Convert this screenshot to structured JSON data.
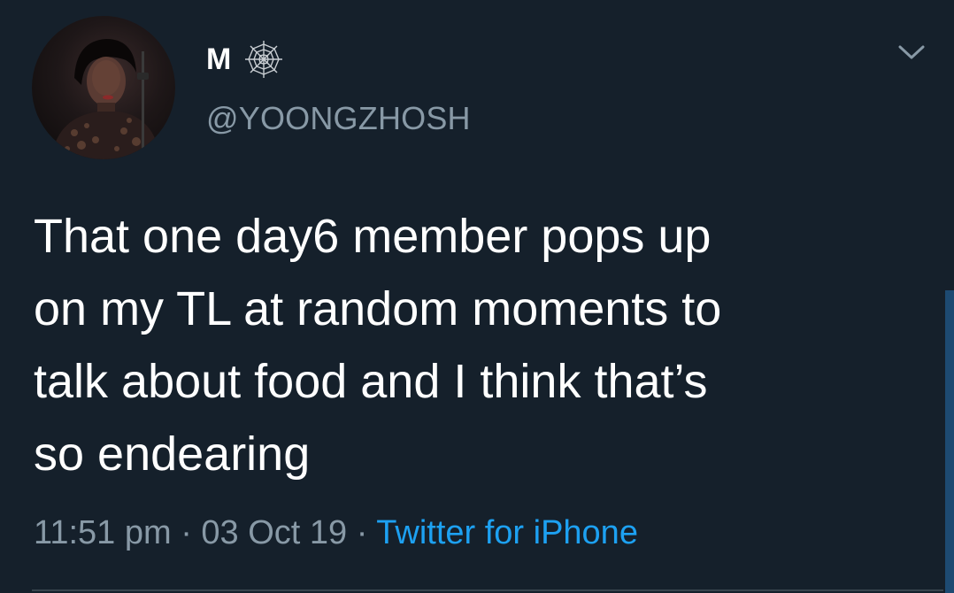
{
  "tweet": {
    "author": {
      "display_name": "M",
      "name_emoji": "spider-web-icon",
      "handle": "@YOONGZHOSH",
      "avatar": "profile-photo"
    },
    "more_icon": "chevron-down-icon",
    "text": "That one day6 member pops up\non my TL at random moments to\ntalk about food and I think that’s\nso endearing",
    "time": "11:51 pm",
    "date": "03 Oct 19",
    "separator": "·",
    "source": "Twitter for iPhone"
  },
  "colors": {
    "background": "#15202b",
    "text_primary": "#ffffff",
    "text_secondary": "#8899a6",
    "accent": "#1da1f2"
  }
}
